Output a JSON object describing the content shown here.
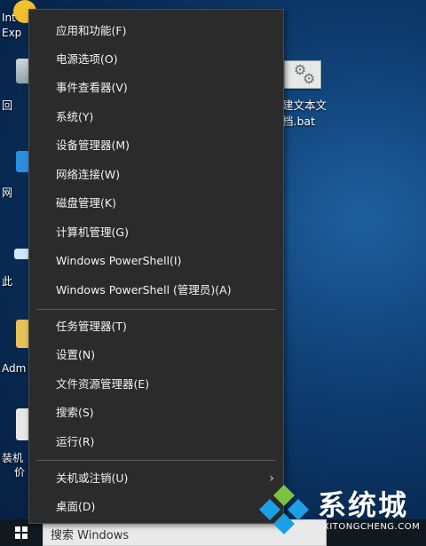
{
  "menu": {
    "items": [
      {
        "label": "应用和功能(F)"
      },
      {
        "label": "电源选项(O)"
      },
      {
        "label": "事件查看器(V)"
      },
      {
        "label": "系统(Y)"
      },
      {
        "label": "设备管理器(M)"
      },
      {
        "label": "网络连接(W)"
      },
      {
        "label": "磁盘管理(K)"
      },
      {
        "label": "计算机管理(G)"
      },
      {
        "label": "Windows PowerShell(I)"
      },
      {
        "label": "Windows PowerShell (管理员)(A)"
      },
      {
        "label": "任务管理器(T)"
      },
      {
        "label": "设置(N)"
      },
      {
        "label": "文件资源管理器(E)"
      },
      {
        "label": "搜索(S)"
      },
      {
        "label": "运行(R)"
      },
      {
        "label": "关机或注销(U)",
        "submenu_arrow": "›"
      },
      {
        "label": "桌面(D)"
      }
    ]
  },
  "desktop": {
    "left_icons": [
      {
        "label": "Int\nExp",
        "icon": "internet-explorer-icon"
      },
      {
        "label": "回",
        "icon": "recycle-bin-icon"
      },
      {
        "label": "网",
        "icon": "network-icon"
      },
      {
        "label": "此",
        "icon": "this-pc-icon"
      },
      {
        "label": "Adm",
        "icon": "folder-icon"
      },
      {
        "label": "装机\n价",
        "icon": "installer-icon"
      }
    ],
    "file_icon": {
      "label_line1": "建文本文",
      "label_line2": "档.bat",
      "icon": "batch-file-gear-icon"
    }
  },
  "taskbar": {
    "search_placeholder": "搜索 Windows"
  },
  "watermark": {
    "title": "系统城",
    "url": "XITONGCHENG.COM"
  },
  "colors": {
    "menu_bg": "#2b2b2b",
    "menu_text": "#f2f2f2",
    "desktop_blue": "#0f3f74"
  }
}
